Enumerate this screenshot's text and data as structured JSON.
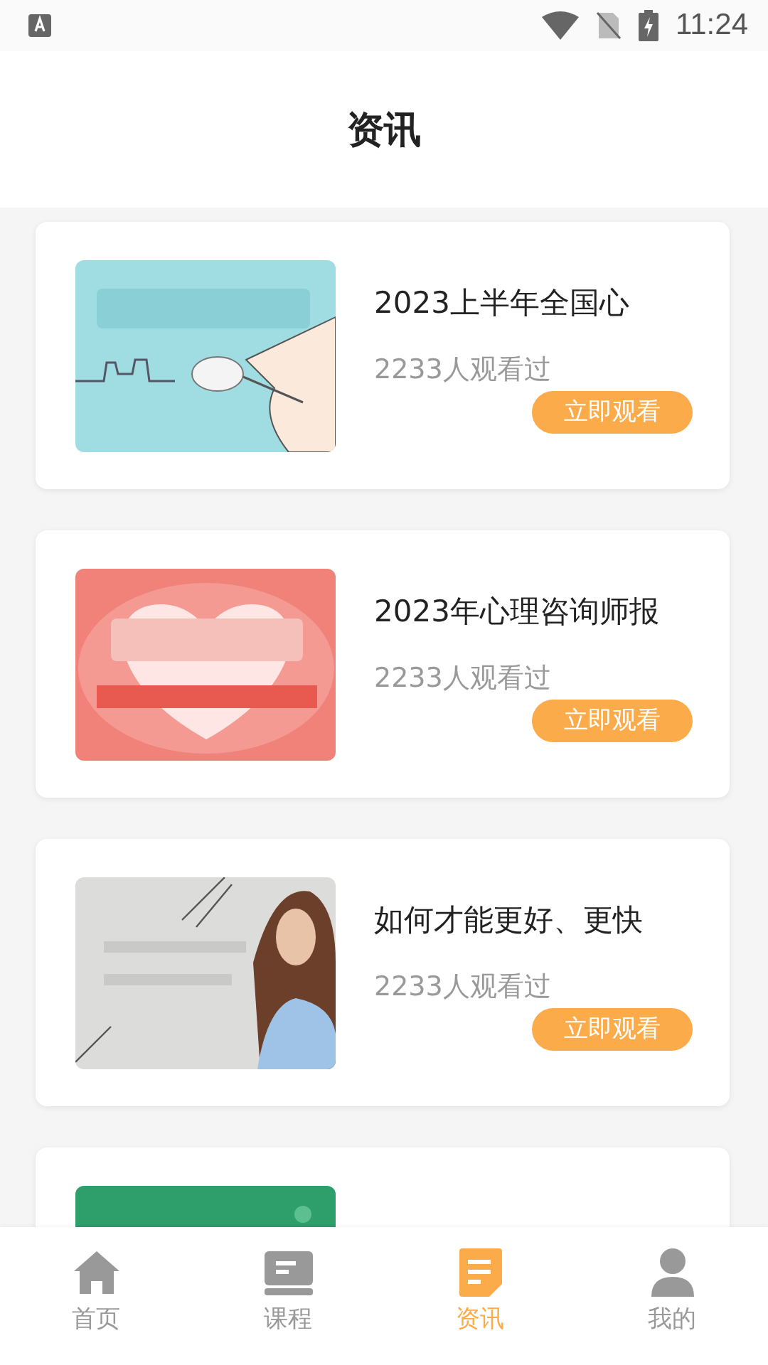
{
  "status_bar": {
    "time": "11:24"
  },
  "header": {
    "title": "资讯"
  },
  "articles": [
    {
      "title": "2023上半年全国心",
      "views": "2233人观看过",
      "button": "立即观看",
      "kind": "picture"
    },
    {
      "title": "2023年心理咨询师报",
      "views": "2233人观看过",
      "button": "立即观看",
      "kind": "picture"
    },
    {
      "title": "如何才能更好、更快",
      "views": "2233人观看过",
      "button": "立即观看",
      "kind": "picture"
    },
    {
      "kind": "picture"
    }
  ],
  "tab_bar": [
    {
      "label": "首页",
      "kind": "home",
      "selected": false
    },
    {
      "label": "课程",
      "kind": "course",
      "selected": false
    },
    {
      "label": "资讯",
      "kind": "news",
      "selected": true
    },
    {
      "label": "我的",
      "kind": "profile",
      "selected": false
    }
  ]
}
